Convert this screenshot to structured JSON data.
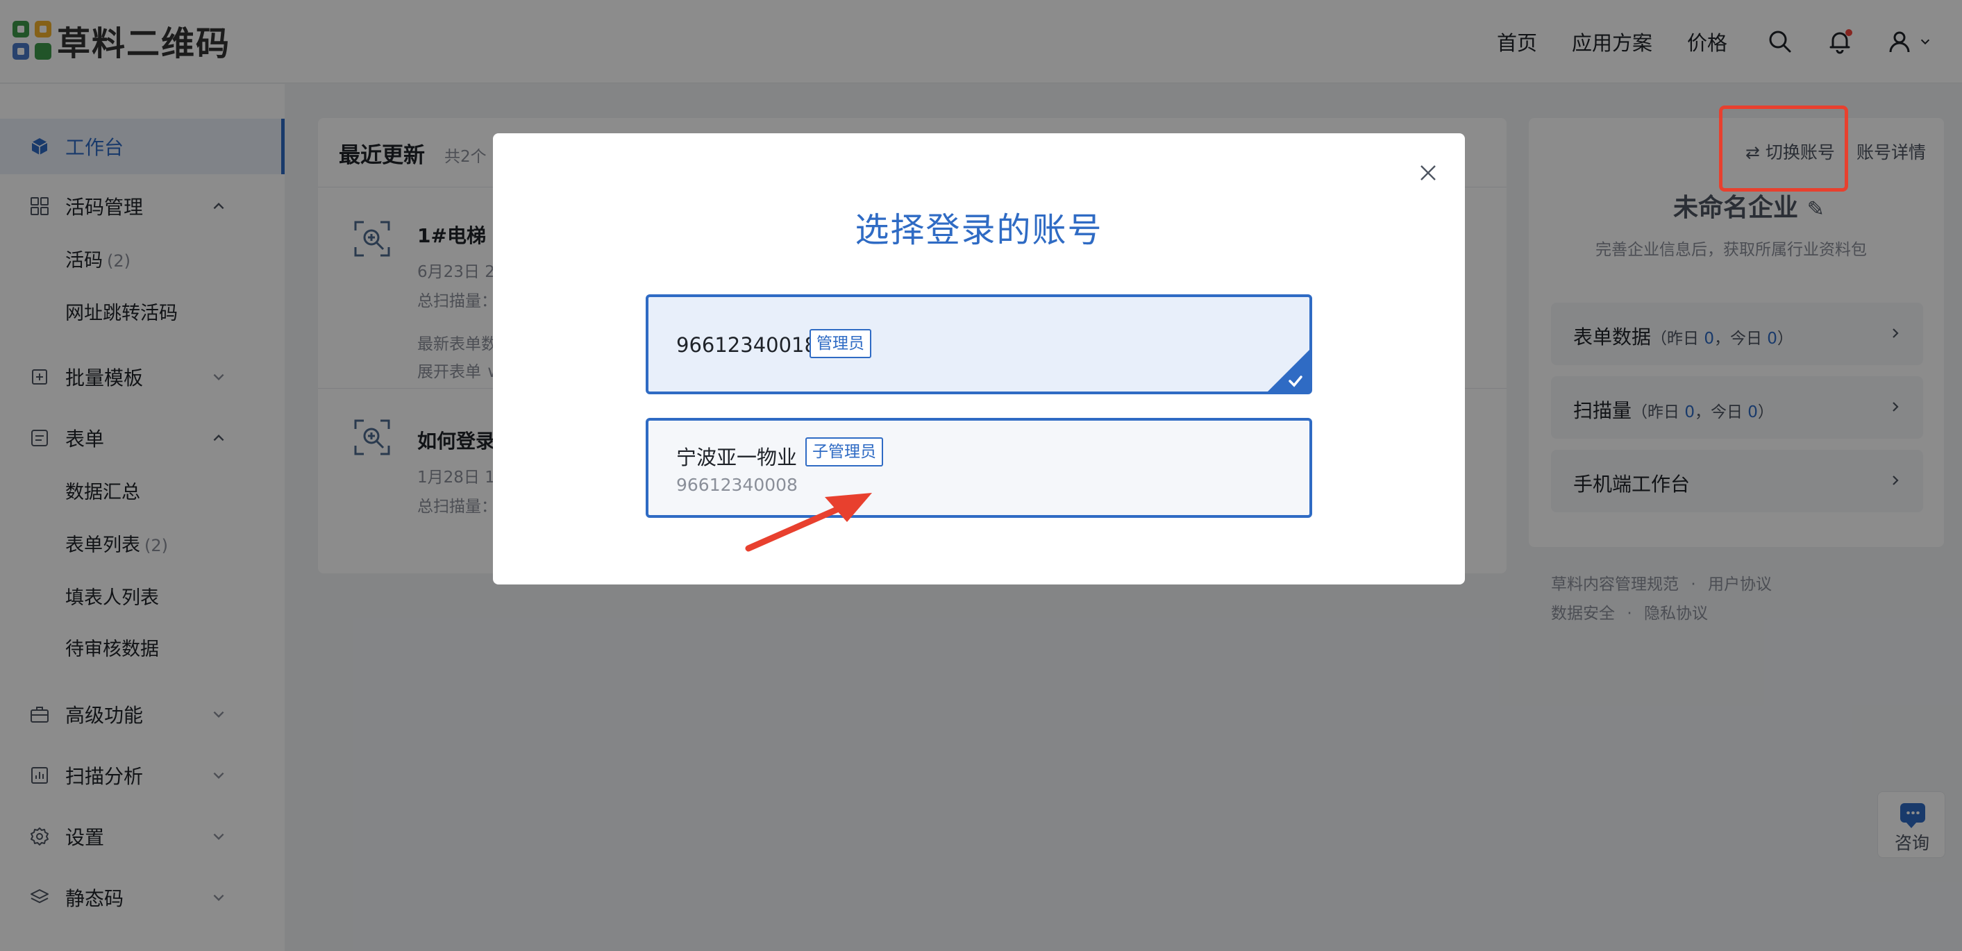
{
  "header": {
    "logo_text": "草料二维码",
    "nav": [
      "首页",
      "应用方案",
      "价格"
    ]
  },
  "sidebar": {
    "workbench": "工作台",
    "live_code": "活码管理",
    "live_code_sub": {
      "label": "活码",
      "count": "(2)"
    },
    "url_jump": "网址跳转活码",
    "batch": "批量模板",
    "form": "表单",
    "data_summary": "数据汇总",
    "form_list": {
      "label": "表单列表",
      "count": "(2)"
    },
    "filler_list": "填表人列表",
    "pending": "待审核数据",
    "advanced": "高级功能",
    "scan_analysis": "扫描分析",
    "settings": "设置",
    "static_code": "静态码"
  },
  "recent": {
    "title": "最近更新",
    "count": "共2个",
    "items": [
      {
        "title": "1#电梯",
        "date": "6月23日 2",
        "scans": "总扫描量：",
        "extra1": "最新表单数",
        "extra2": "展开表单 ∨"
      },
      {
        "title": "如何登录",
        "date": "1月28日 1",
        "scans": "总扫描量："
      }
    ]
  },
  "account_panel": {
    "switch": "切换账号",
    "detail": "账号详情",
    "enterprise": "未命名企业",
    "enterprise_sub": "完善企业信息后，获取所属行业资料包",
    "form_data": {
      "label": "表单数据",
      "pre": "（昨日 ",
      "y": "0",
      "mid": "，今日 ",
      "t": "0",
      "post": "）"
    },
    "scan_count": {
      "label": "扫描量",
      "pre": "（昨日 ",
      "y": "0",
      "mid": "，今日 ",
      "t": "0",
      "post": "）"
    },
    "mobile": "手机端工作台",
    "footer1": [
      "草料内容管理规范",
      "·",
      "用户协议"
    ],
    "footer2": [
      "数据安全",
      "·",
      "隐私协议"
    ],
    "consult": "咨询"
  },
  "modal": {
    "title": "选择登录的账号",
    "accounts": [
      {
        "name": "96612340018",
        "tag": "管理员",
        "selected": true
      },
      {
        "name": "宁波亚一物业",
        "tag": "子管理员",
        "sub": "96612340008",
        "selected": false
      }
    ]
  },
  "colors": {
    "accent": "#2f6bc4",
    "highlight": "#e8402e"
  }
}
